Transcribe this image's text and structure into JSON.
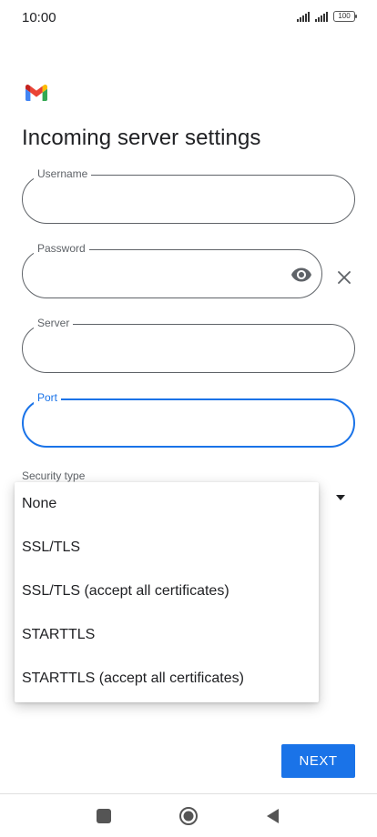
{
  "status_bar": {
    "time": "10:00",
    "battery": "100"
  },
  "logo": {
    "icon": "gmail-logo"
  },
  "page": {
    "title": "Incoming server settings"
  },
  "fields": {
    "username": {
      "label": "Username",
      "value": ""
    },
    "password": {
      "label": "Password",
      "value": "",
      "visibility_icon": "eye-icon",
      "clear_icon": "close-icon"
    },
    "server": {
      "label": "Server",
      "value": ""
    },
    "port": {
      "label": "Port",
      "value": "",
      "focused": true
    }
  },
  "security": {
    "label": "Security type",
    "options": [
      "None",
      "SSL/TLS",
      "SSL/TLS (accept all certificates)",
      "STARTTLS",
      "STARTTLS (accept all certificates)"
    ]
  },
  "actions": {
    "next_label": "NEXT"
  },
  "colors": {
    "accent": "#1a73e8",
    "text": "#202124",
    "outline": "#5f6368"
  }
}
